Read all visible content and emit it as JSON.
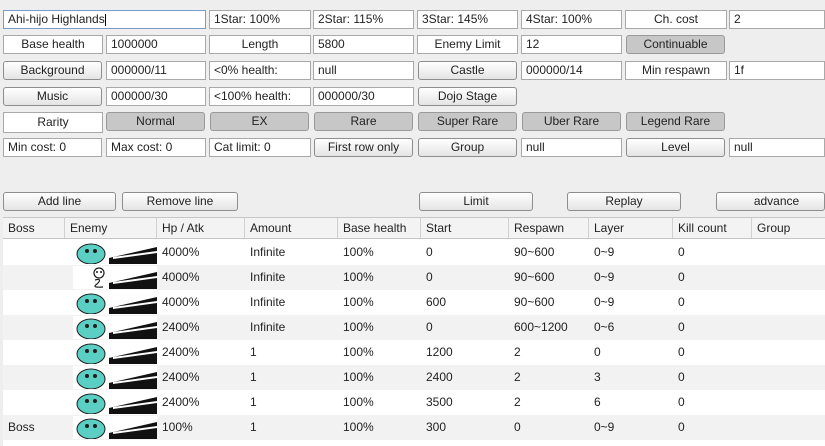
{
  "form": {
    "stage_name": "Ahi-hijo Highlands",
    "star1": "1Star: 100%",
    "star2": "2Star: 115%",
    "star3": "3Star: 145%",
    "star4": "4Star: 100%",
    "ch_cost_label": "Ch. cost",
    "ch_cost_value": "2",
    "base_health_label": "Base health",
    "base_health_value": "1000000",
    "length_label": "Length",
    "length_value": "5800",
    "enemy_limit_label": "Enemy Limit",
    "enemy_limit_value": "12",
    "continuable_label": "Continuable",
    "background_button": "Background",
    "background_value": "000000/11",
    "health0_label": "<0% health:",
    "health0_value": "null",
    "castle_button": "Castle",
    "castle_value": "000000/14",
    "min_respawn_label": "Min respawn",
    "min_respawn_value": "1f",
    "music_button": "Music",
    "music_value": "000000/30",
    "health100_label": "<100% health:",
    "health100_value": "000000/30",
    "dojo_stage_button": "Dojo Stage",
    "rarity_label": "Rarity",
    "rarity_options": [
      "Normal",
      "EX",
      "Rare",
      "Super Rare",
      "Uber Rare",
      "Legend Rare"
    ],
    "min_cost": "Min cost: 0",
    "max_cost": "Max cost: 0",
    "cat_limit": "Cat limit: 0",
    "first_row_only": "First row only",
    "group_button": "Group",
    "group_value": "null",
    "level_button": "Level",
    "level_value": "null"
  },
  "toolbar": {
    "add_line": "Add line",
    "remove_line": "Remove line",
    "limit": "Limit",
    "replay": "Replay",
    "advance": "advance"
  },
  "table": {
    "headers": [
      "Boss",
      "Enemy",
      "Hp / Atk",
      "Amount",
      "Base health",
      "Start",
      "Respawn",
      "Layer",
      "Kill count",
      "Group"
    ],
    "rows": [
      {
        "boss": "",
        "enemy_icon": "teal-dino-icon",
        "hp": "4000%",
        "amount": "Infinite",
        "base": "100%",
        "start": "0",
        "respawn": "90~600",
        "layer": "0~9",
        "kill": "0",
        "group": ""
      },
      {
        "boss": "",
        "enemy_icon": "skull-snake-icon",
        "hp": "4000%",
        "amount": "Infinite",
        "base": "100%",
        "start": "0",
        "respawn": "90~600",
        "layer": "0~9",
        "kill": "0",
        "group": ""
      },
      {
        "boss": "",
        "enemy_icon": "teal-dino-icon",
        "hp": "4000%",
        "amount": "Infinite",
        "base": "100%",
        "start": "600",
        "respawn": "90~600",
        "layer": "0~9",
        "kill": "0",
        "group": ""
      },
      {
        "boss": "",
        "enemy_icon": "teal-dino-icon",
        "hp": "2400%",
        "amount": "Infinite",
        "base": "100%",
        "start": "0",
        "respawn": "600~1200",
        "layer": "0~6",
        "kill": "0",
        "group": ""
      },
      {
        "boss": "",
        "enemy_icon": "teal-dino-icon",
        "hp": "2400%",
        "amount": "1",
        "base": "100%",
        "start": "1200",
        "respawn": "2",
        "layer": "0",
        "kill": "0",
        "group": ""
      },
      {
        "boss": "",
        "enemy_icon": "teal-dino-icon",
        "hp": "2400%",
        "amount": "1",
        "base": "100%",
        "start": "2400",
        "respawn": "2",
        "layer": "3",
        "kill": "0",
        "group": ""
      },
      {
        "boss": "",
        "enemy_icon": "teal-dino-icon",
        "hp": "2400%",
        "amount": "1",
        "base": "100%",
        "start": "3500",
        "respawn": "2",
        "layer": "6",
        "kill": "0",
        "group": ""
      },
      {
        "boss": "Boss",
        "enemy_icon": "teal-dino-icon",
        "hp": "100%",
        "amount": "1",
        "base": "100%",
        "start": "300",
        "respawn": "0",
        "layer": "0~9",
        "kill": "0",
        "group": ""
      }
    ]
  }
}
